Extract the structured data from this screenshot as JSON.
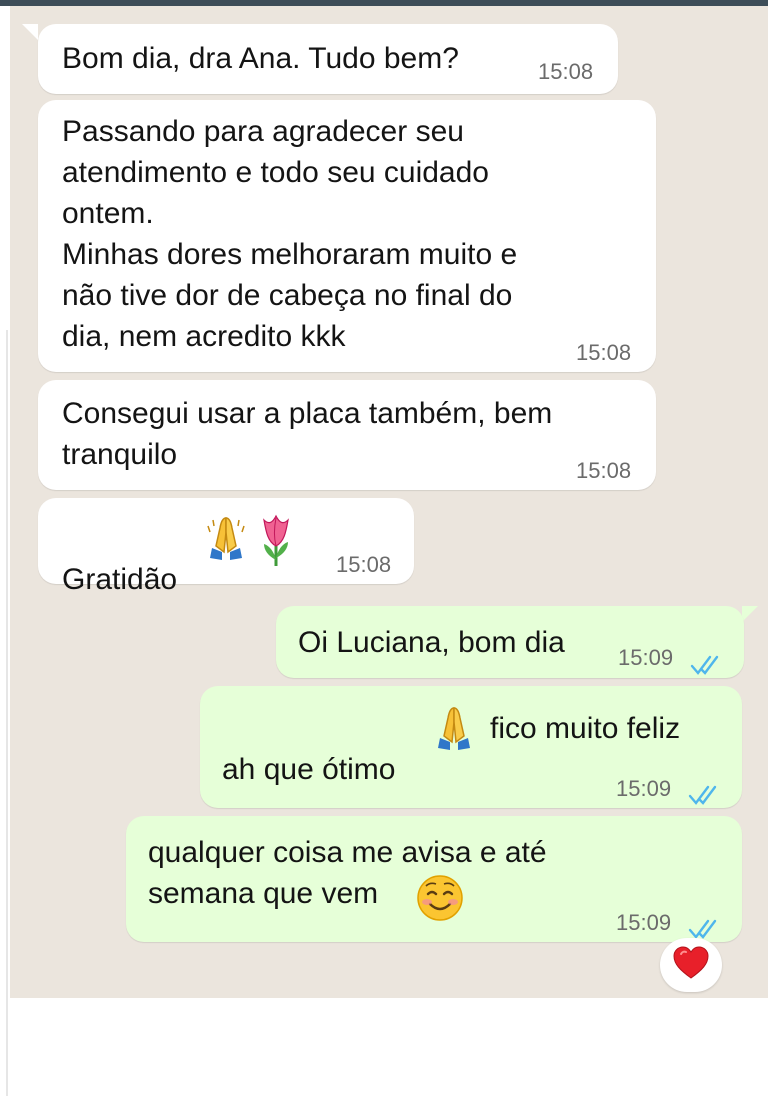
{
  "messages": [
    {
      "direction": "in",
      "text": "Bom dia, dra Ana. Tudo bem?",
      "time": "15:08"
    },
    {
      "direction": "in",
      "text": "Passando para agradecer seu\natendimento e todo seu cuidado\nontem.\nMinhas dores melhoraram muito e\nnão tive dor de cabeça no final do\ndia,  nem acredito kkk",
      "time": "15:08"
    },
    {
      "direction": "in",
      "text": "Consegui usar a placa também, bem\ntranquilo",
      "time": "15:08"
    },
    {
      "direction": "in",
      "text": "Gratidão",
      "emojis": [
        "folded-hands",
        "tulip"
      ],
      "time": "15:08"
    },
    {
      "direction": "out",
      "text": "Oi Luciana, bom dia",
      "time": "15:09",
      "status": "read"
    },
    {
      "direction": "out",
      "text_before": "ah que ótimo",
      "text_after": "fico muito feliz",
      "emoji": "folded-hands",
      "time": "15:09",
      "status": "read"
    },
    {
      "direction": "out",
      "text": "qualquer coisa me avisa e até\nsemana que vem",
      "emoji": "smiling-face",
      "time": "15:09",
      "status": "read"
    }
  ],
  "reaction": {
    "emoji": "red-heart"
  },
  "colors": {
    "incoming_bubble": "#ffffff",
    "outgoing_bubble": "#e6ffd8",
    "chat_background": "#ebe5dd",
    "read_ticks": "#4fb6ec",
    "header_strip": "#3d4d58"
  }
}
